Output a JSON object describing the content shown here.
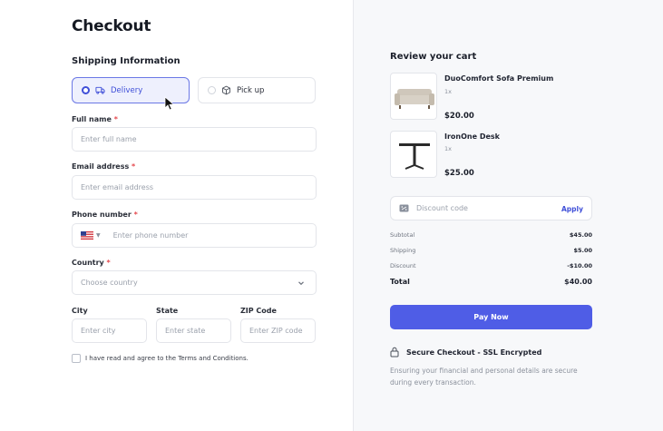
{
  "page_title": "Checkout",
  "shipping": {
    "heading": "Shipping Information",
    "options": [
      {
        "label": "Delivery",
        "selected": true
      },
      {
        "label": "Pick up",
        "selected": false
      }
    ]
  },
  "form": {
    "full_name": {
      "label": "Full name",
      "placeholder": "Enter full name"
    },
    "email": {
      "label": "Email address",
      "placeholder": "Enter email address"
    },
    "phone": {
      "label": "Phone number",
      "placeholder": "Enter phone number",
      "country_flag": "us-flag-icon"
    },
    "country": {
      "label": "Country",
      "placeholder": "Choose country"
    },
    "city": {
      "label": "City",
      "placeholder": "Enter city"
    },
    "state": {
      "label": "State",
      "placeholder": "Enter state"
    },
    "zip": {
      "label": "ZIP Code",
      "placeholder": "Enter ZIP code"
    },
    "required_mark": "*",
    "terms": "I have read and agree to the Terms and Conditions."
  },
  "cart": {
    "heading": "Review your cart",
    "items": [
      {
        "name": "DuoComfort Sofa Premium",
        "qty": "1x",
        "price": "$20.00"
      },
      {
        "name": "IronOne Desk",
        "qty": "1x",
        "price": "$25.00"
      }
    ],
    "discount": {
      "placeholder": "Discount code",
      "apply_label": "Apply"
    },
    "summary": [
      {
        "label": "Subtotal",
        "value": "$45.00"
      },
      {
        "label": "Shipping",
        "value": "$5.00"
      },
      {
        "label": "Discount",
        "value": "-$10.00"
      }
    ],
    "total": {
      "label": "Total",
      "value": "$40.00"
    },
    "pay_label": "Pay Now",
    "secure_title": "Secure Checkout - SSL Encrypted",
    "secure_note": "Ensuring your financial and personal details are secure during every transaction."
  },
  "colors": {
    "accent": "#4f5de6",
    "required": "#e5484d",
    "panel": "#f7f8fa"
  }
}
